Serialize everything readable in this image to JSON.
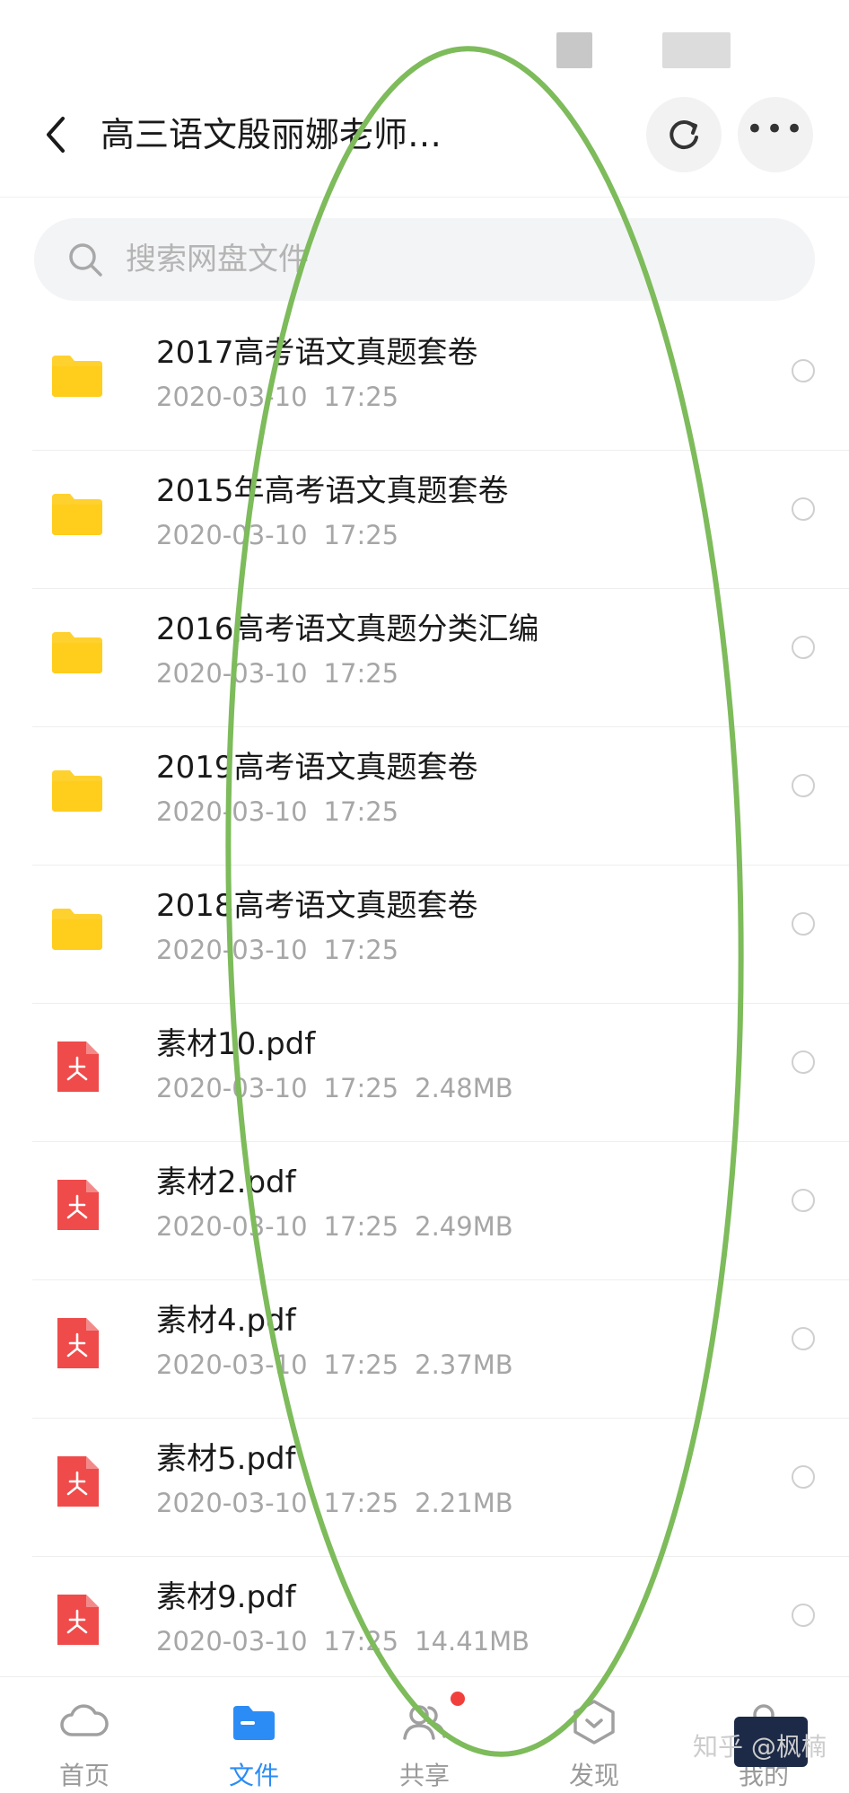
{
  "header": {
    "title": "高三语文殷丽娜老师…",
    "icons": [
      "back-chevron-icon",
      "refresh-icon",
      "more-icon"
    ]
  },
  "search": {
    "placeholder": "搜索网盘文件",
    "icon": "search-icon"
  },
  "files": [
    {
      "type": "folder",
      "name": "2017高考语文真题套卷",
      "date": "2020-03-10",
      "time": "17:25",
      "size": ""
    },
    {
      "type": "folder",
      "name": "2015年高考语文真题套卷",
      "date": "2020-03-10",
      "time": "17:25",
      "size": ""
    },
    {
      "type": "folder",
      "name": "2016高考语文真题分类汇编",
      "date": "2020-03-10",
      "time": "17:25",
      "size": ""
    },
    {
      "type": "folder",
      "name": "2019高考语文真题套卷",
      "date": "2020-03-10",
      "time": "17:25",
      "size": ""
    },
    {
      "type": "folder",
      "name": "2018高考语文真题套卷",
      "date": "2020-03-10",
      "time": "17:25",
      "size": ""
    },
    {
      "type": "pdf",
      "name": "素材10.pdf",
      "date": "2020-03-10",
      "time": "17:25",
      "size": "2.48MB"
    },
    {
      "type": "pdf",
      "name": "素材2.pdf",
      "date": "2020-03-10",
      "time": "17:25",
      "size": "2.49MB"
    },
    {
      "type": "pdf",
      "name": "素材4.pdf",
      "date": "2020-03-10",
      "time": "17:25",
      "size": "2.37MB"
    },
    {
      "type": "pdf",
      "name": "素材5.pdf",
      "date": "2020-03-10",
      "time": "17:25",
      "size": "2.21MB"
    },
    {
      "type": "pdf",
      "name": "素材9.pdf",
      "date": "2020-03-10",
      "time": "17:25",
      "size": "14.41MB"
    }
  ],
  "tabbar": {
    "tabs": [
      {
        "label": "首页",
        "icon": "cloud-icon",
        "active": false
      },
      {
        "label": "文件",
        "icon": "folder-icon",
        "active": true
      },
      {
        "label": "共享",
        "icon": "people-icon",
        "active": false,
        "badge": true
      },
      {
        "label": "发现",
        "icon": "discover-icon",
        "active": false
      },
      {
        "label": "我的",
        "icon": "profile-icon",
        "active": false
      }
    ]
  },
  "watermark": "知乎 @枫楠",
  "colors": {
    "accent": "#2b8cf5",
    "folder": "#ffd12e",
    "pdf": "#ef4b4b",
    "annotation": "#7dbb5b",
    "badge": "#f1403c"
  }
}
